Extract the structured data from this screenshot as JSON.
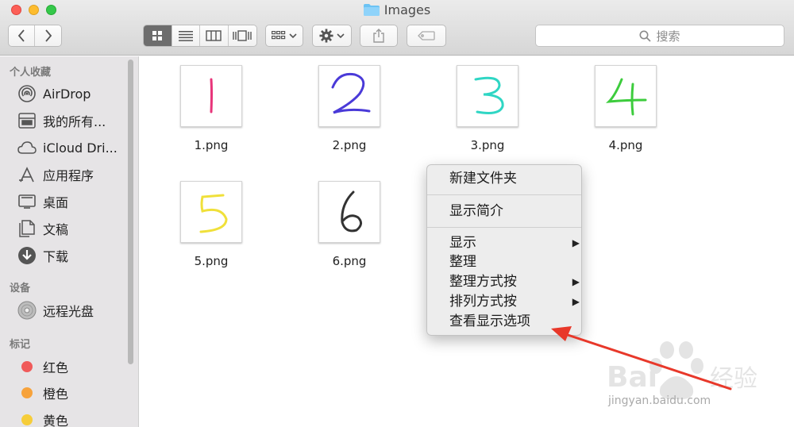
{
  "window": {
    "title": "Images"
  },
  "toolbar": {
    "view_modes": [
      "icon-view",
      "list-view",
      "column-view",
      "cover-flow-view"
    ],
    "search_placeholder": "搜索"
  },
  "sidebar": {
    "sections": [
      {
        "title": "个人收藏",
        "items": [
          {
            "label": "AirDrop",
            "icon": "airdrop-icon"
          },
          {
            "label": "我的所有...",
            "icon": "all-files-icon"
          },
          {
            "label": "iCloud Dri...",
            "icon": "cloud-icon"
          },
          {
            "label": "应用程序",
            "icon": "applications-icon"
          },
          {
            "label": "桌面",
            "icon": "desktop-icon"
          },
          {
            "label": "文稿",
            "icon": "documents-icon"
          },
          {
            "label": "下载",
            "icon": "downloads-icon"
          }
        ]
      },
      {
        "title": "设备",
        "items": [
          {
            "label": "远程光盘",
            "icon": "disc-icon"
          }
        ]
      },
      {
        "title": "标记",
        "items": [
          {
            "label": "红色",
            "color": "#f05a5a"
          },
          {
            "label": "橙色",
            "color": "#f7a23b"
          },
          {
            "label": "黄色",
            "color": "#f6cd3a"
          }
        ]
      }
    ]
  },
  "files": [
    {
      "name": "1.png",
      "digit": "1",
      "color": "#e8357a"
    },
    {
      "name": "2.png",
      "digit": "2",
      "color": "#4a3ad8"
    },
    {
      "name": "3.png",
      "digit": "3",
      "color": "#2fd6c4"
    },
    {
      "name": "4.png",
      "digit": "4",
      "color": "#3dcc3d"
    },
    {
      "name": "5.png",
      "digit": "5",
      "color": "#f0e03a"
    },
    {
      "name": "6.png",
      "digit": "6",
      "color": "#333333"
    }
  ],
  "context_menu": {
    "items": [
      {
        "label": "新建文件夹"
      },
      {
        "label": "显示简介"
      },
      {
        "label": "显示",
        "submenu": true
      },
      {
        "label": "整理"
      },
      {
        "label": "整理方式按",
        "submenu": true
      },
      {
        "label": "排列方式按",
        "submenu": true
      },
      {
        "label": "查看显示选项"
      }
    ]
  },
  "annotation": {
    "arrow_color": "#e8382a"
  },
  "watermark": {
    "brand": "Bai 经验",
    "url": "jingyan.baidu.com"
  }
}
